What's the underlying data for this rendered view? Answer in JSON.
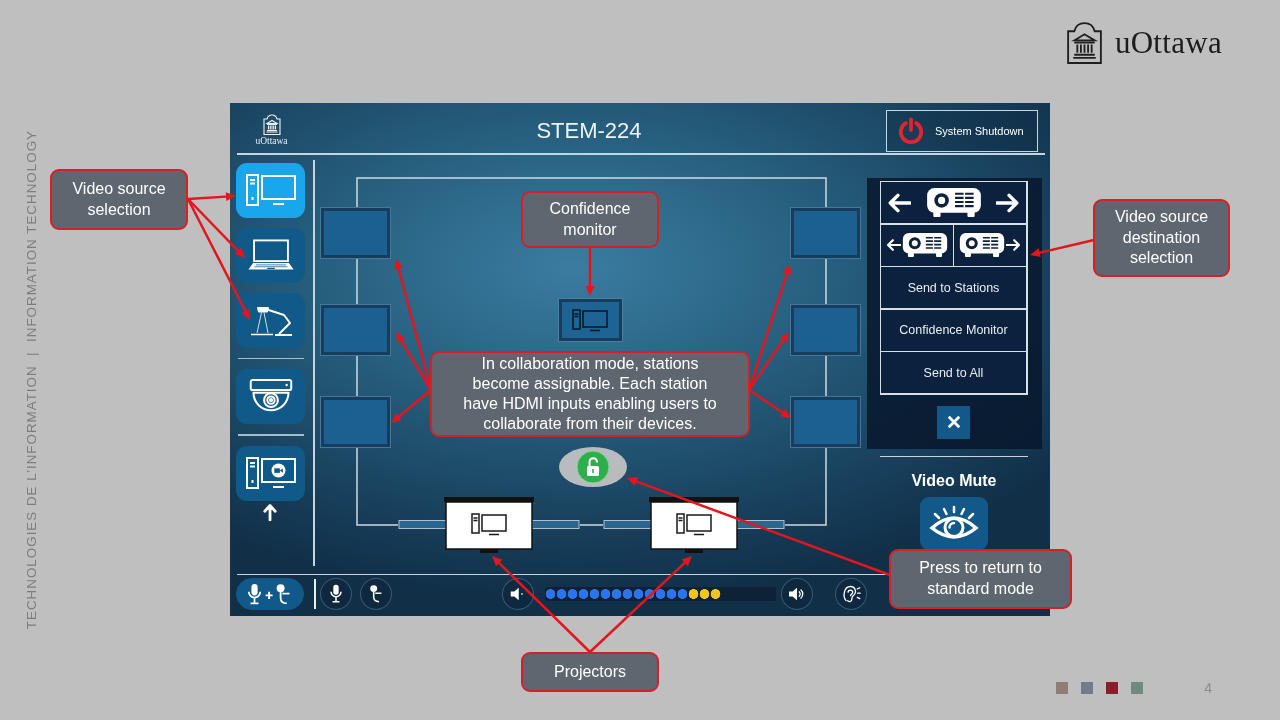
{
  "logo": {
    "text": "uOttawa"
  },
  "side_caption": "TECHNOLOGIES DE L’INFORMATION  |  INFORMATION TECHNOLOGY",
  "panel": {
    "logo_text": "uOttawa",
    "room_title": "STEM-224",
    "shutdown_button": {
      "label": "System Shutdown"
    },
    "source_groups": [
      [
        {
          "kind": "desktop",
          "selected": true
        },
        {
          "kind": "laptop",
          "selected": false
        },
        {
          "kind": "document_camera",
          "selected": false
        }
      ],
      [
        {
          "kind": "room_camera",
          "selected": false
        }
      ],
      [
        {
          "kind": "video_conference",
          "selected": false
        }
      ]
    ],
    "collaboration_lock": {
      "locked": false
    },
    "destinations": [
      {
        "kind": "projectors_both",
        "selected": false
      },
      {
        "kind": "projector_left",
        "selected": false
      },
      {
        "kind": "projector_right",
        "selected": false
      },
      {
        "kind": "text",
        "label": "Send to Stations",
        "selected": false
      },
      {
        "kind": "text",
        "label": "Confidence Monitor",
        "selected": false
      },
      {
        "kind": "text",
        "label": "Send to All",
        "selected": false
      }
    ],
    "video_mute": {
      "label": "Video Mute",
      "muted": false
    },
    "mic_modes": [
      {
        "kind": "handheld_and_lapel",
        "selected": true
      },
      {
        "kind": "handheld",
        "selected": false
      },
      {
        "kind": "lapel",
        "selected": false
      }
    ],
    "volume": {
      "level": 0.76
    }
  },
  "callouts": [
    {
      "text": "Video source selection"
    },
    {
      "text": "Confidence monitor"
    },
    {
      "text": "In collaboration mode, stations become assignable. Each station have HDMI inputs enabling users to collaborate from their devices."
    },
    {
      "text": "Video source destination selection"
    },
    {
      "text": "Press to return to standard mode"
    },
    {
      "text": "Projectors"
    }
  ],
  "page_number": "4"
}
